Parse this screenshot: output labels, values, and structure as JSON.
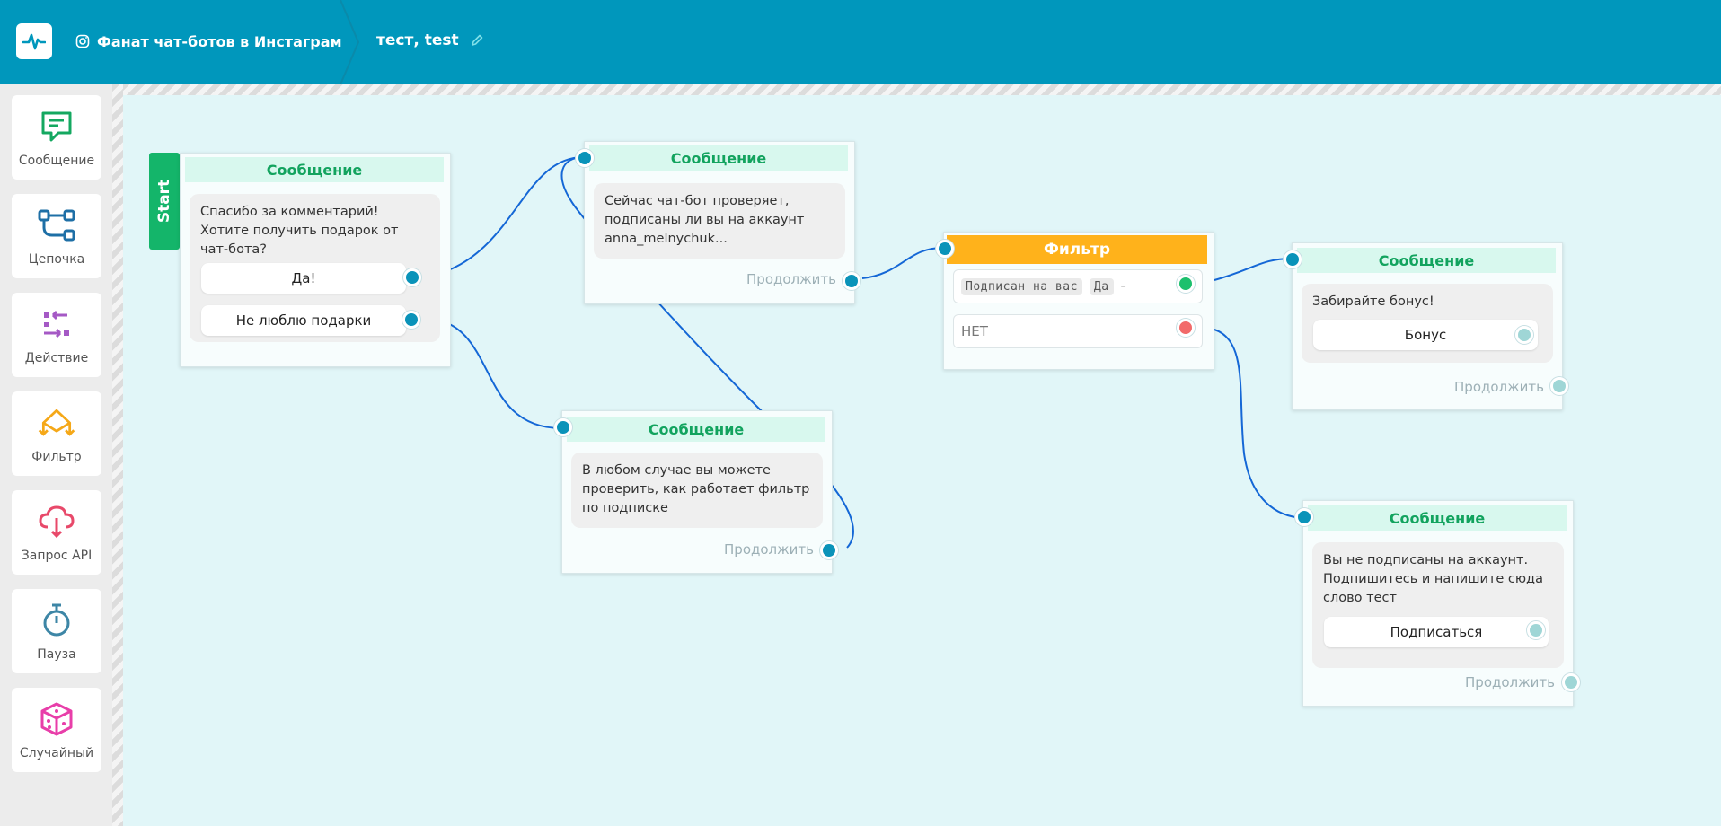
{
  "header": {
    "project_name": "Фанат чат-ботов в Инстаграм",
    "flow_name": "тест, test",
    "accent_color": "#0097bc"
  },
  "sidebar": {
    "tools": [
      {
        "label": "Сообщение",
        "icon": "message-icon",
        "color": "#14a860"
      },
      {
        "label": "Цепочка",
        "icon": "chain-icon",
        "color": "#1e6fa6"
      },
      {
        "label": "Действие",
        "icon": "action-icon",
        "color": "#a559c5"
      },
      {
        "label": "Фильтр",
        "icon": "filter-icon",
        "color": "#f5a818"
      },
      {
        "label": "Запрос API",
        "icon": "api-cloud-icon",
        "color": "#e8496a"
      },
      {
        "label": "Пауза",
        "icon": "stopwatch-icon",
        "color": "#3d86a6"
      },
      {
        "label": "Случайный",
        "icon": "dice-icon",
        "color": "#e83ea9"
      }
    ]
  },
  "nodes": {
    "start_label": "Start",
    "msg1": {
      "title": "Сообщение",
      "text": "Спасибо за комментарий! Хотите получить подарок от чат-бота?",
      "buttons": [
        "Да!",
        "Не люблю подарки"
      ]
    },
    "msg2": {
      "title": "Сообщение",
      "text": "Сейчас чат-бот проверяет, подписаны ли вы на аккаунт anna_melnychuk...",
      "continue": "Продолжить"
    },
    "msg3": {
      "title": "Сообщение",
      "text": "В любом случае вы можете проверить, как работает фильтр по подписке",
      "continue": "Продолжить"
    },
    "filter": {
      "title": "Фильтр",
      "condition_field": "Подписан на вас",
      "condition_value": "Да",
      "else_label": "НЕТ"
    },
    "msg4": {
      "title": "Сообщение",
      "text": "Забирайте бонус!",
      "button": "Бонус",
      "continue": "Продолжить"
    },
    "msg5": {
      "title": "Сообщение",
      "text": "Вы не подписаны на аккаунт. Подпишитесь и напишите сюда слово тест",
      "button": "Подписаться",
      "continue": "Продолжить"
    }
  }
}
